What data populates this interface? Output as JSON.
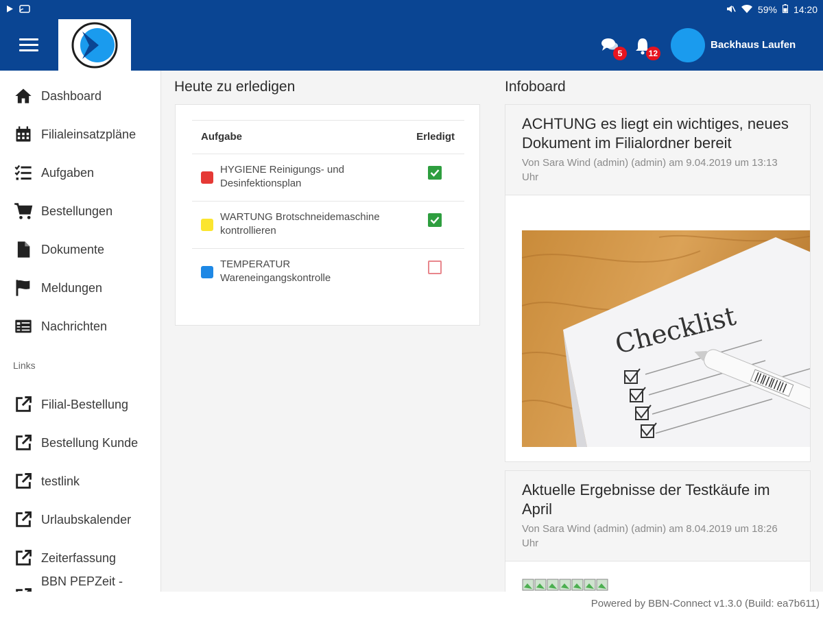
{
  "status_bar": {
    "battery": "59%",
    "time": "14:20"
  },
  "header": {
    "chat_badge": "5",
    "notification_badge": "12",
    "user_name": "Backhaus Laufen"
  },
  "sidebar": {
    "items": [
      {
        "label": "Dashboard",
        "icon": "home-icon"
      },
      {
        "label": "Filialeinsatzpläne",
        "icon": "calendar-icon"
      },
      {
        "label": "Aufgaben",
        "icon": "checklist-icon"
      },
      {
        "label": "Bestellungen",
        "icon": "cart-icon"
      },
      {
        "label": "Dokumente",
        "icon": "document-icon"
      },
      {
        "label": "Meldungen",
        "icon": "flag-icon"
      },
      {
        "label": "Nachrichten",
        "icon": "newspaper-icon"
      }
    ],
    "links_heading": "Links",
    "links": [
      {
        "label": "Filial-Bestellung",
        "icon": "external-link-icon"
      },
      {
        "label": "Bestellung Kunde",
        "icon": "external-link-icon"
      },
      {
        "label": "testlink",
        "icon": "external-link-icon"
      },
      {
        "label": "Urlaubskalender",
        "icon": "external-link-icon"
      },
      {
        "label": "Zeiterfassung",
        "icon": "external-link-icon"
      },
      {
        "label": "BBN PEPZeit -",
        "icon": "external-link-icon"
      }
    ]
  },
  "tasks": {
    "heading": "Heute zu erledigen",
    "col_task": "Aufgabe",
    "col_done": "Erledigt",
    "rows": [
      {
        "text": "HYGIENE Reinigungs- und Desinfektionsplan",
        "color": "#e53935",
        "done": true
      },
      {
        "text": "WARTUNG Brotschneidemaschine kontrollieren",
        "color": "#fbe52f",
        "done": true
      },
      {
        "text": "TEMPERATUR Wareneingangskontrolle",
        "color": "#1e88e5",
        "done": false
      }
    ]
  },
  "infoboard": {
    "heading": "Infoboard",
    "posts": [
      {
        "title": "ACHTUNG es liegt ein wichtiges, neues Dokument im Filialordner bereit",
        "meta": "Von Sara Wind (admin) (admin) am 9.04.2019 um 13:13 Uhr",
        "image_text": "Checklist"
      },
      {
        "title": "Aktuelle Ergebnisse der Testkäufe im April",
        "meta": "Von Sara Wind (admin) (admin) am 8.04.2019 um 18:26 Uhr"
      }
    ]
  },
  "colors": {
    "brand": "#0a4593",
    "success": "#2e9e3f",
    "danger": "#e6141f"
  },
  "footer": {
    "text": "Powered by BBN-Connect v1.3.0 (Build: ea7b611)"
  }
}
